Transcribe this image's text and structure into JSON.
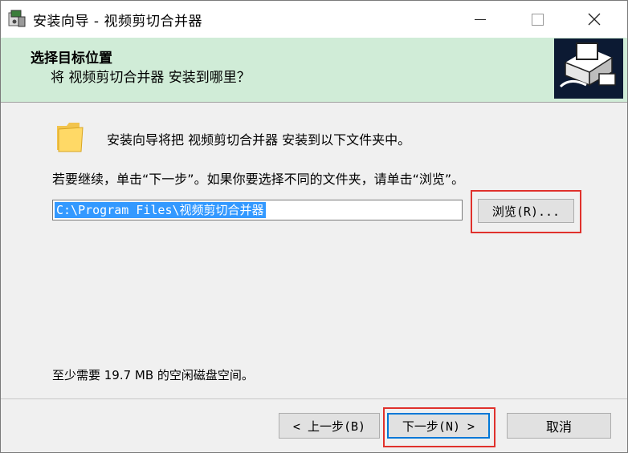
{
  "window": {
    "title": "安装向导 - 视频剪切合并器",
    "controls": {
      "minimize": "minimize",
      "maximize": "maximize",
      "close": "close"
    }
  },
  "header": {
    "title": "选择目标位置",
    "subtitle": "将 视频剪切合并器 安装到哪里？"
  },
  "body": {
    "info": "安装向导将把 视频剪切合并器 安装到以下文件夹中。",
    "instruction": "若要继续，单击“下一步”。如果你要选择不同的文件夹，请单击“浏览”。",
    "path_value": "C:\\Program Files\\视频剪切合并器",
    "browse_label": "浏览(R)...",
    "disk_space": "至少需要 19.7 MB 的空闲磁盘空间。"
  },
  "footer": {
    "back_label": "< 上一步(B)",
    "next_label": "下一步(N) >",
    "cancel_label": "取消"
  },
  "colors": {
    "header_bg": "#d0ecd7",
    "selection": "#3399ff",
    "highlight": "#e0312c",
    "default_button_border": "#0078d7"
  }
}
